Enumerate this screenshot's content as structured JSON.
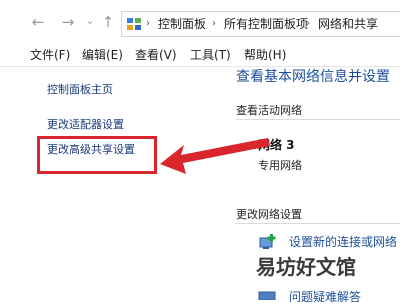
{
  "address_bar": {
    "crumbs": [
      "控制面板",
      "所有控制面板项",
      "网络和共享"
    ]
  },
  "menu": [
    "文件(F)",
    "编辑(E)",
    "查看(V)",
    "工具(T)",
    "帮助(H)"
  ],
  "sidebar": {
    "links": [
      "控制面板主页",
      "更改适配器设置",
      "更改高级共享设置"
    ]
  },
  "main": {
    "title": "查看基本网络信息并设置",
    "active_label": "查看活动网络",
    "network_name": "网络 3",
    "network_type": "专用网络",
    "change_label": "更改网络设置",
    "actions": [
      "设置新的连接或网络",
      "问题疑难解答"
    ]
  },
  "watermark": "易坊好文馆",
  "colors": {
    "link": "#1d4f9a",
    "highlight": "#d8262c"
  }
}
